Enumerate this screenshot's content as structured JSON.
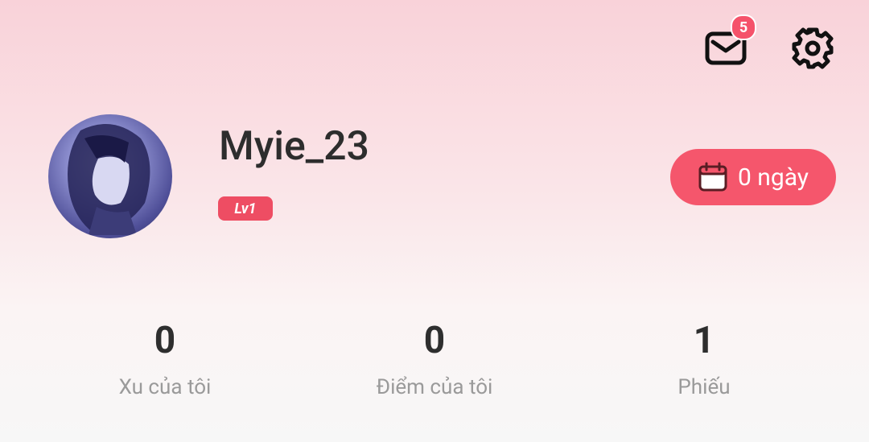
{
  "header": {
    "mail_badge": "5",
    "mail_icon": "mail-icon",
    "settings_icon": "gear-icon"
  },
  "profile": {
    "username": "Myie_23",
    "level": "Lv1",
    "checkin_label": "0 ngày",
    "checkin_icon": "calendar-icon"
  },
  "stats": [
    {
      "value": "0",
      "label": "Xu của tôi"
    },
    {
      "value": "0",
      "label": "Điểm của tôi"
    },
    {
      "value": "1",
      "label": "Phiếu"
    }
  ],
  "colors": {
    "accent": "#f5566c",
    "badge": "#ee4d63"
  }
}
